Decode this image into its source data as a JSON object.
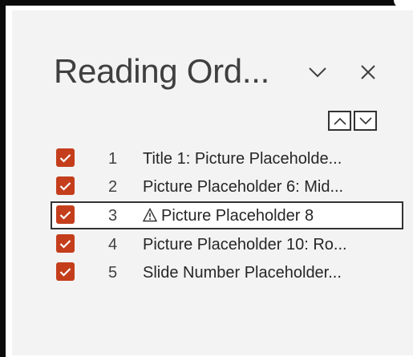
{
  "pane": {
    "title": "Reading Ord...",
    "collapse_icon": "chevron-down-icon",
    "close_icon": "close-icon"
  },
  "order_controls": {
    "move_up_icon": "chevron-up-icon",
    "move_down_icon": "chevron-down-icon"
  },
  "items": [
    {
      "index": "1",
      "label": "Title 1: Picture Placeholde...",
      "checked": true,
      "selected": false,
      "warning": false
    },
    {
      "index": "2",
      "label": "Picture Placeholder 6: Mid...",
      "checked": true,
      "selected": false,
      "warning": false
    },
    {
      "index": "3",
      "label": "Picture Placeholder 8",
      "checked": true,
      "selected": true,
      "warning": true
    },
    {
      "index": "4",
      "label": "Picture Placeholder 10: Ro...",
      "checked": true,
      "selected": false,
      "warning": false
    },
    {
      "index": "5",
      "label": "Slide Number Placeholder...",
      "checked": true,
      "selected": false,
      "warning": false
    }
  ],
  "colors": {
    "checkbox": "#c43e1c",
    "pane_background": "#f3f3f3",
    "frame": "#0b0b0b"
  }
}
